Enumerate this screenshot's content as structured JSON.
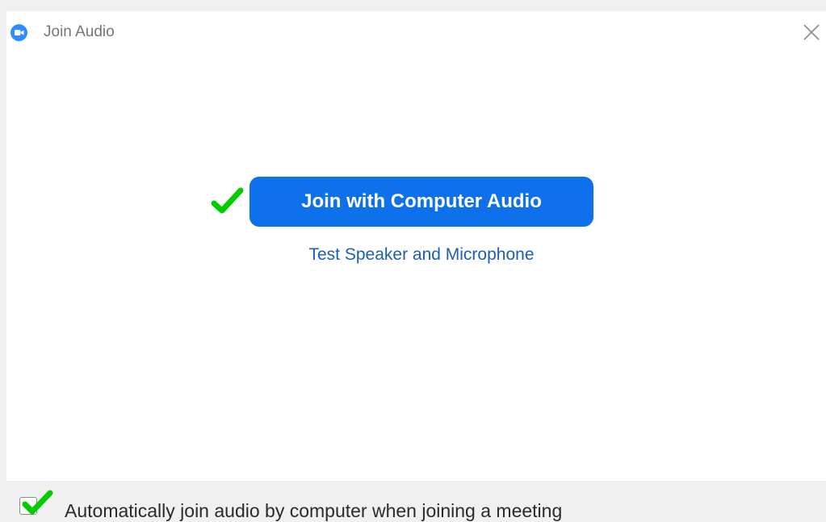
{
  "window": {
    "title": "Join Audio",
    "app_icon": "zoom-video-camera-icon",
    "close_icon": "close-icon"
  },
  "main": {
    "join_button_label": "Join with Computer Audio",
    "test_link_label": "Test Speaker and Microphone"
  },
  "footer": {
    "auto_join_label": "Automatically join audio by computer when joining a meeting",
    "auto_join_checked": true
  },
  "annotations": {
    "checkmark_icon": "green-checkmark-icon",
    "checkmark_color": "#00cc00"
  },
  "colors": {
    "accent": "#0e71eb",
    "link": "#1a5fb4",
    "app_icon": "#2d8cff"
  }
}
